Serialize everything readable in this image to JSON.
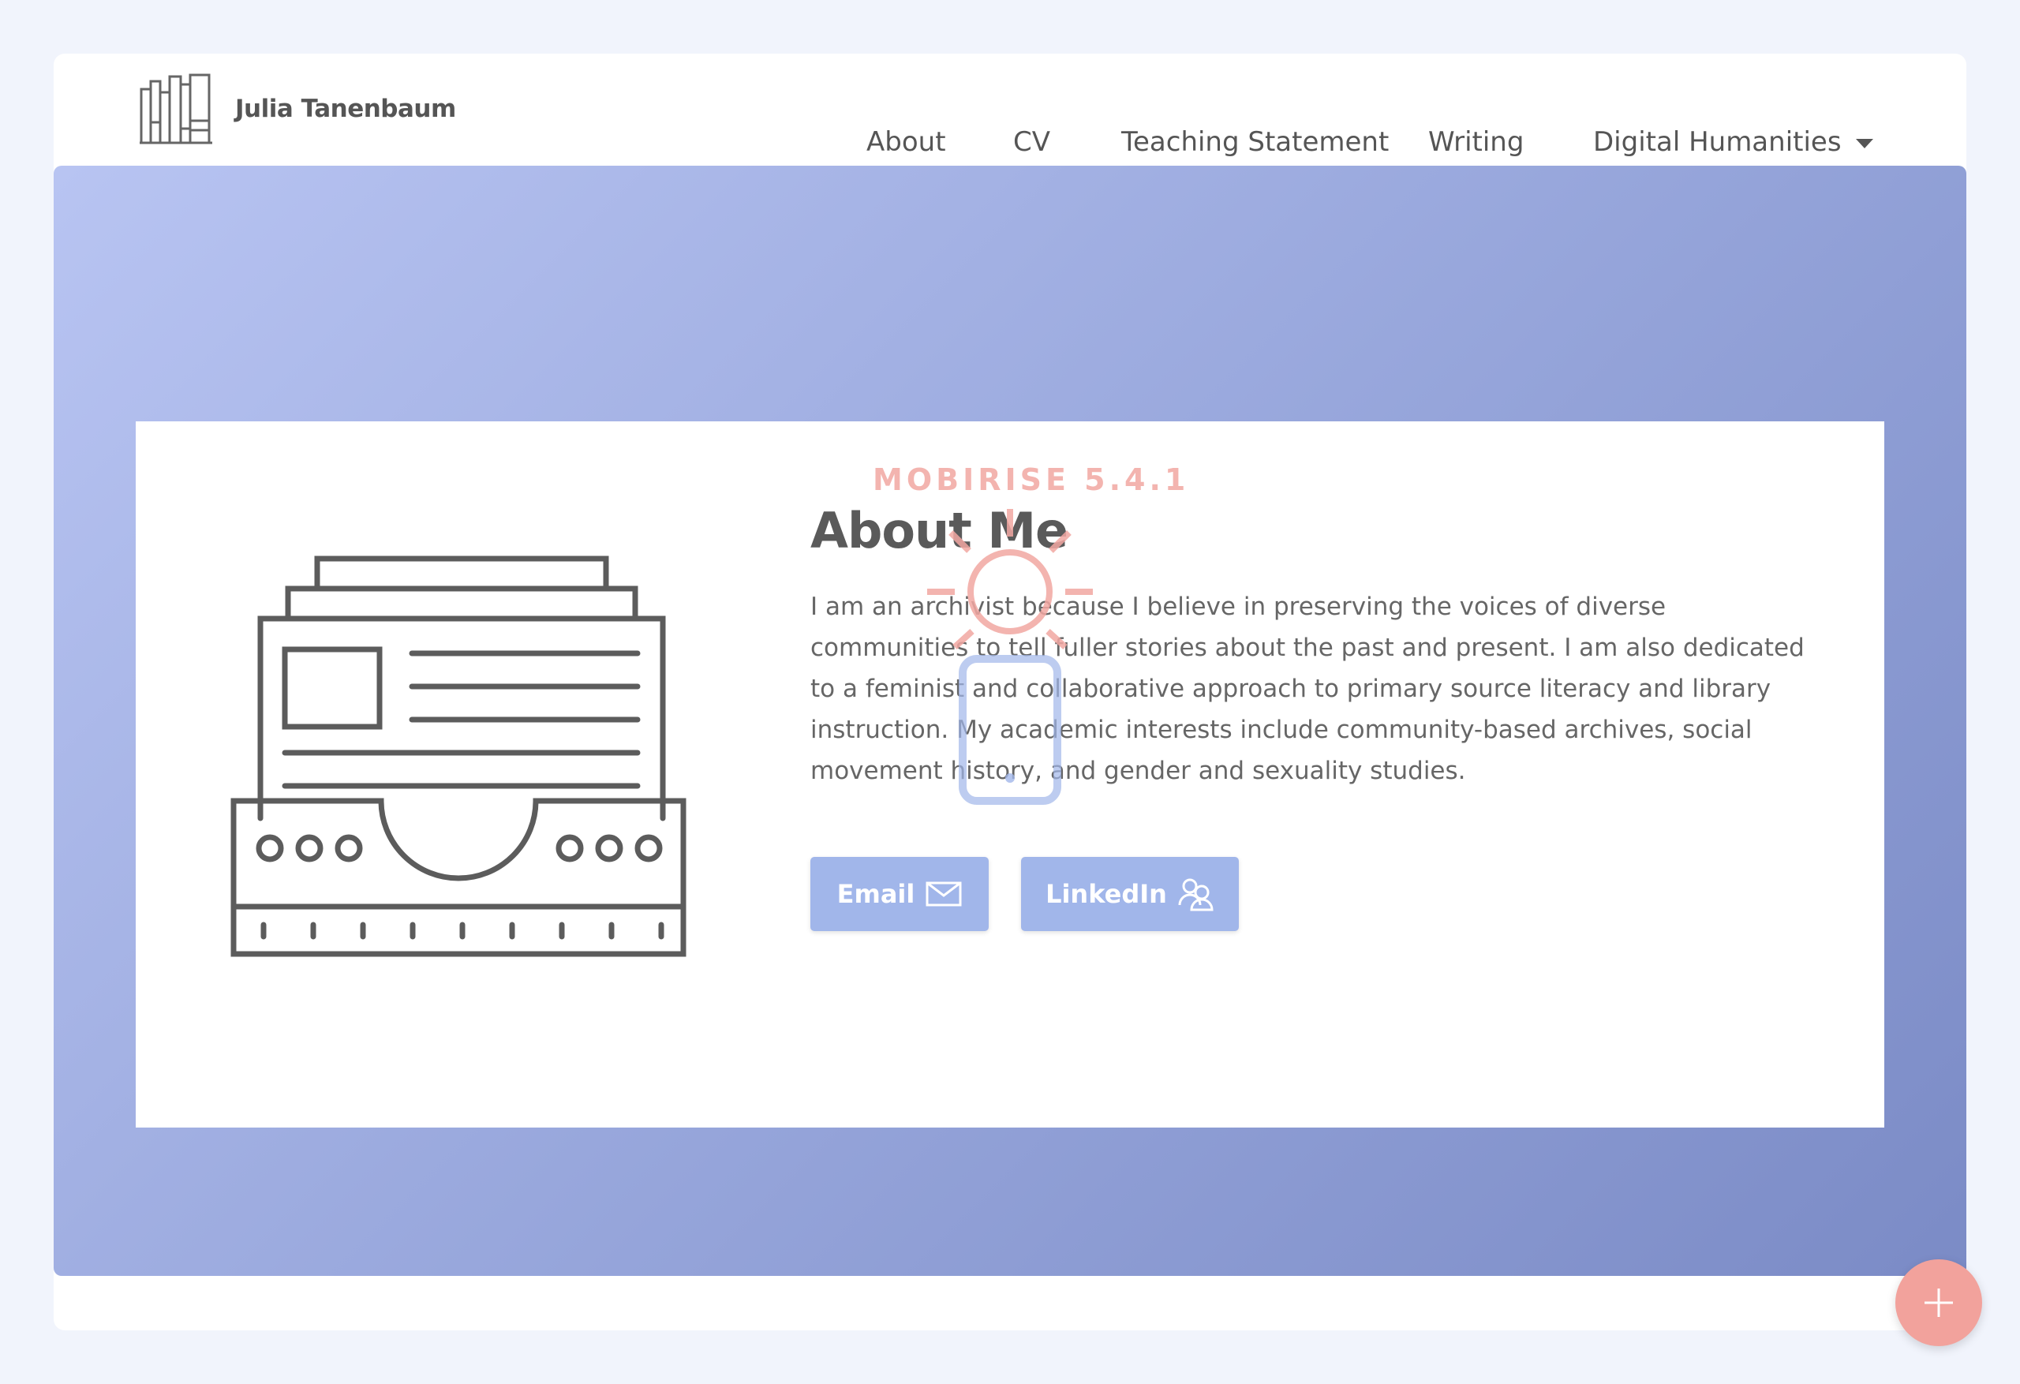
{
  "brand": {
    "name": "Julia Tanenbaum",
    "logo_icon": "bookshelf-icon"
  },
  "nav": {
    "items": [
      {
        "label": "About"
      },
      {
        "label": "CV"
      },
      {
        "label": "Teaching Statement"
      },
      {
        "label": "Writing"
      },
      {
        "label": "Digital Humanities",
        "has_dropdown": true
      }
    ]
  },
  "watermark": {
    "text": "MOBIRISE  5.4.1"
  },
  "about": {
    "title": "About Me",
    "body": "I am an archivist because I believe in preserving the voices of diverse communities to tell fuller stories about the past and present. I am also dedicated to a feminist and collaborative approach to primary source literacy and library instruction. My academic interests include community-based archives, social movement history, and gender and sexuality studies.",
    "illustration_icon": "archive-drawer-icon"
  },
  "buttons": {
    "email": {
      "label": "Email",
      "icon": "envelope-icon"
    },
    "linkedin": {
      "label": "LinkedIn",
      "icon": "users-icon"
    }
  },
  "fab": {
    "icon": "plus-icon"
  },
  "colors": {
    "hero_gradient_start": "#b8c4f2",
    "hero_gradient_end": "#7b8bc6",
    "button": "#a1b6ea",
    "fab": "#f2a29c",
    "watermark": "#f2a7a2"
  }
}
